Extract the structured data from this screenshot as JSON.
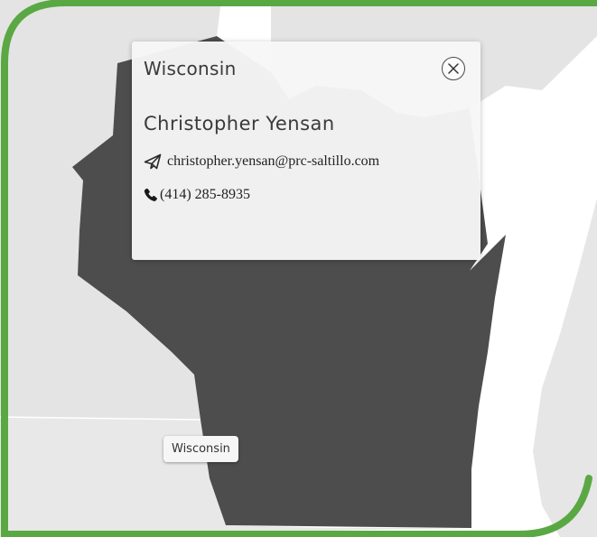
{
  "map": {
    "highlighted_region": "Wisconsin",
    "region_label": "Wisconsin",
    "colors": {
      "highlighted_fill": "#4d4d4d",
      "other_land": "#e6e6e6",
      "water": "#ffffff",
      "frame_border": "#5aa843"
    }
  },
  "popup": {
    "title": "Wisconsin",
    "contact_name": "Christopher Yensan",
    "email": "christopher.yensan@prc-saltillo.com",
    "phone": "(414) 285-8935",
    "icons": {
      "close": "close-icon",
      "email": "paper-plane-icon",
      "phone": "phone-icon"
    }
  }
}
